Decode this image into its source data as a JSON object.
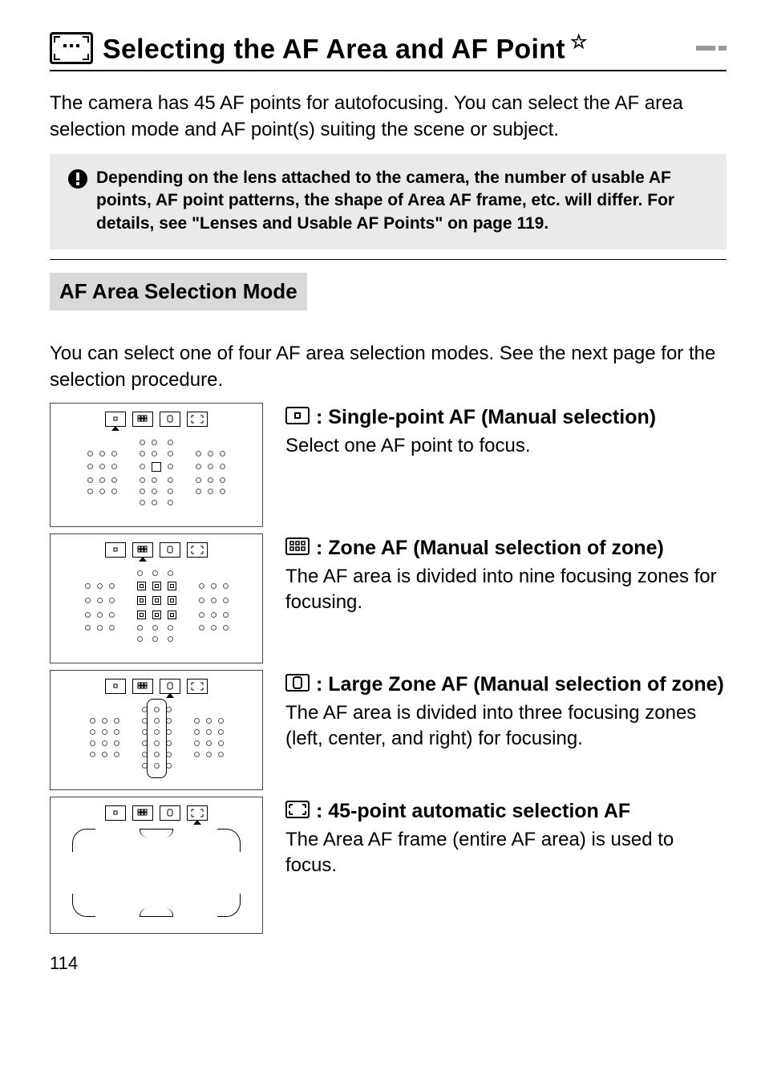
{
  "page": {
    "title": "Selecting the AF Area and AF Point",
    "title_star": "☆",
    "intro": "The camera has 45 AF points for autofocusing. You can select the AF area selection mode and AF point(s) suiting the scene or subject.",
    "warning": "Depending on the lens attached to the camera, the number of usable AF points, AF point patterns, the shape of Area AF frame, etc. will differ. For details, see \"Lenses and Usable AF Points\" on page 119.",
    "subhead": "AF Area Selection Mode",
    "post_sub": "You can select one of four AF area selection modes. See the next page for the selection procedure.",
    "modes": [
      {
        "title": ": Single-point AF (Manual selection)",
        "body": "Select one AF point to focus."
      },
      {
        "title": ": Zone AF (Manual selection of zone)",
        "body": "The AF area is divided into nine focusing zones for focusing."
      },
      {
        "title": ": Large Zone AF (Manual selection of zone)",
        "body": "The AF area is divided into three focusing zones (left, center, and right) for focusing."
      },
      {
        "title": ": 45-point automatic selection AF",
        "body": "The Area AF frame (entire AF area) is used to focus."
      }
    ],
    "page_number": "114"
  }
}
